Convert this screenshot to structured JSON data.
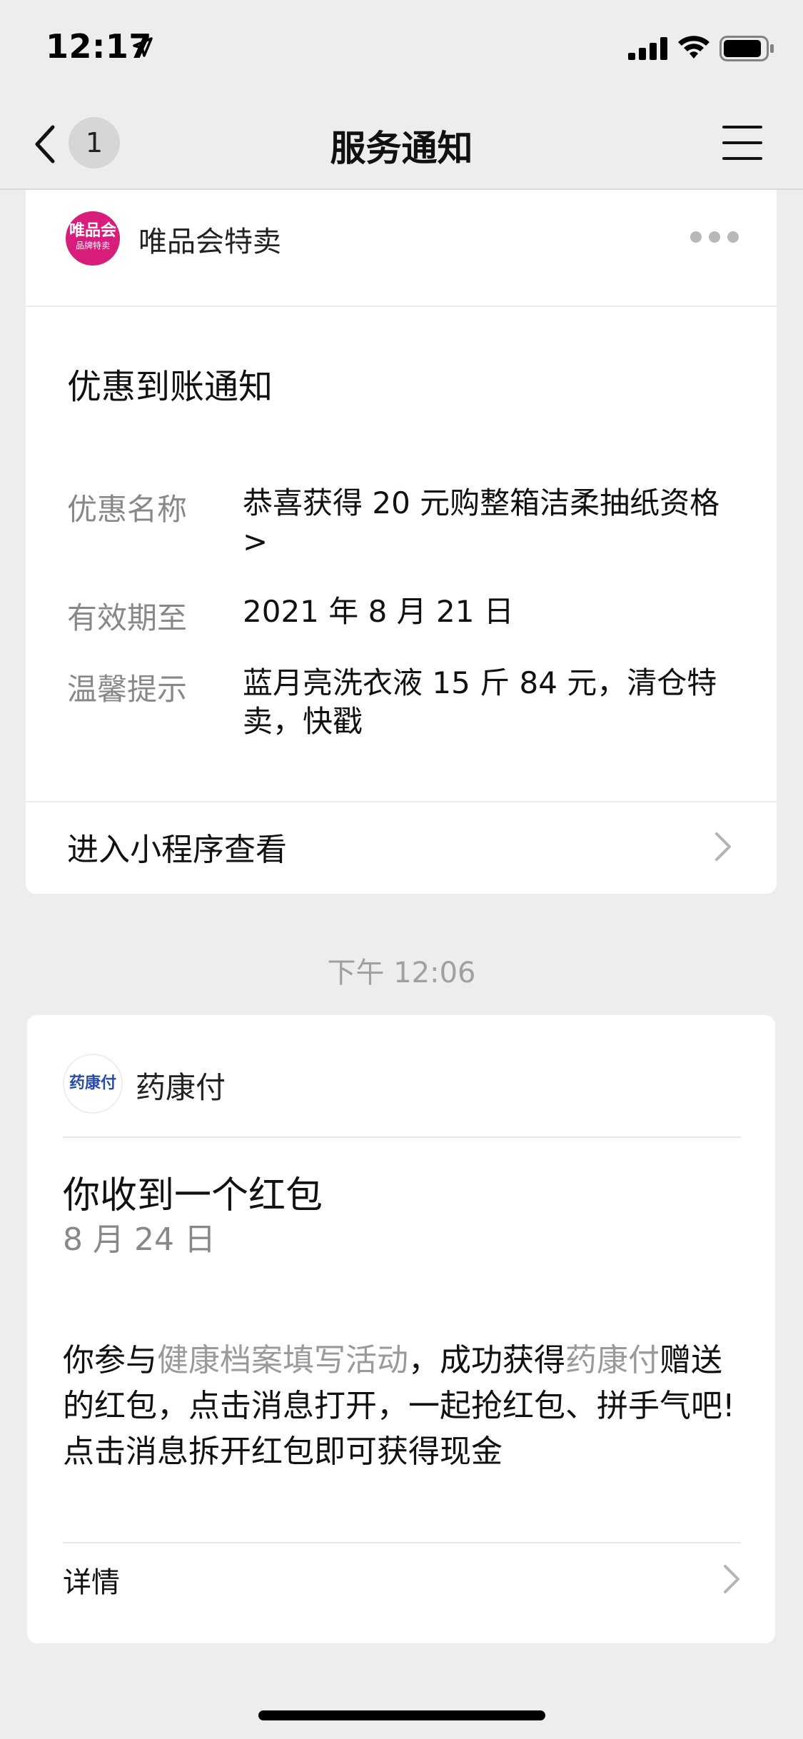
{
  "status_bar": {
    "time": "12:17",
    "icons": [
      "location-arrow-icon",
      "cellular-signal-icon",
      "wifi-icon",
      "battery-icon"
    ]
  },
  "nav": {
    "title": "服务通知",
    "unread_count": "1",
    "icons": [
      "back-chevron-icon",
      "menu-icon"
    ]
  },
  "card1": {
    "brand_logo_text_line1": "唯品会",
    "brand_logo_text_line2": "品牌特卖",
    "brand_name": "唯品会特卖",
    "notice_title": "优惠到账通知",
    "fields": [
      {
        "label": "优惠名称",
        "value": "恭喜获得 20 元购整箱洁柔抽纸资格>"
      },
      {
        "label": "有效期至",
        "value": "2021 年 8 月 21 日"
      },
      {
        "label": "温馨提示",
        "value": "蓝月亮洗衣液 15 斤 84 元，清仓特卖，快戳"
      }
    ],
    "action_label": "进入小程序查看"
  },
  "timestamp": "下午 12:06",
  "card2": {
    "brand_logo_text": "药康付",
    "brand_name": "药康付",
    "title": "你收到一个红包",
    "date": "8 月 24 日",
    "body": {
      "p1_before": "你参与",
      "p1_highlight1": "健康档案填写活动",
      "p1_middle": "，成功获得",
      "p1_highlight2": "药康付",
      "p1_after": "赠送的红包，点击消息打开，一起抢红包、拼手气吧!",
      "p2": "点击消息拆开红包即可获得现金"
    },
    "action_label": "详情"
  },
  "colors": {
    "background": "#ededed",
    "card": "#ffffff",
    "brand_vip": "#d81e7a",
    "muted_text": "#888888",
    "highlight_text": "#9a9a9a"
  }
}
